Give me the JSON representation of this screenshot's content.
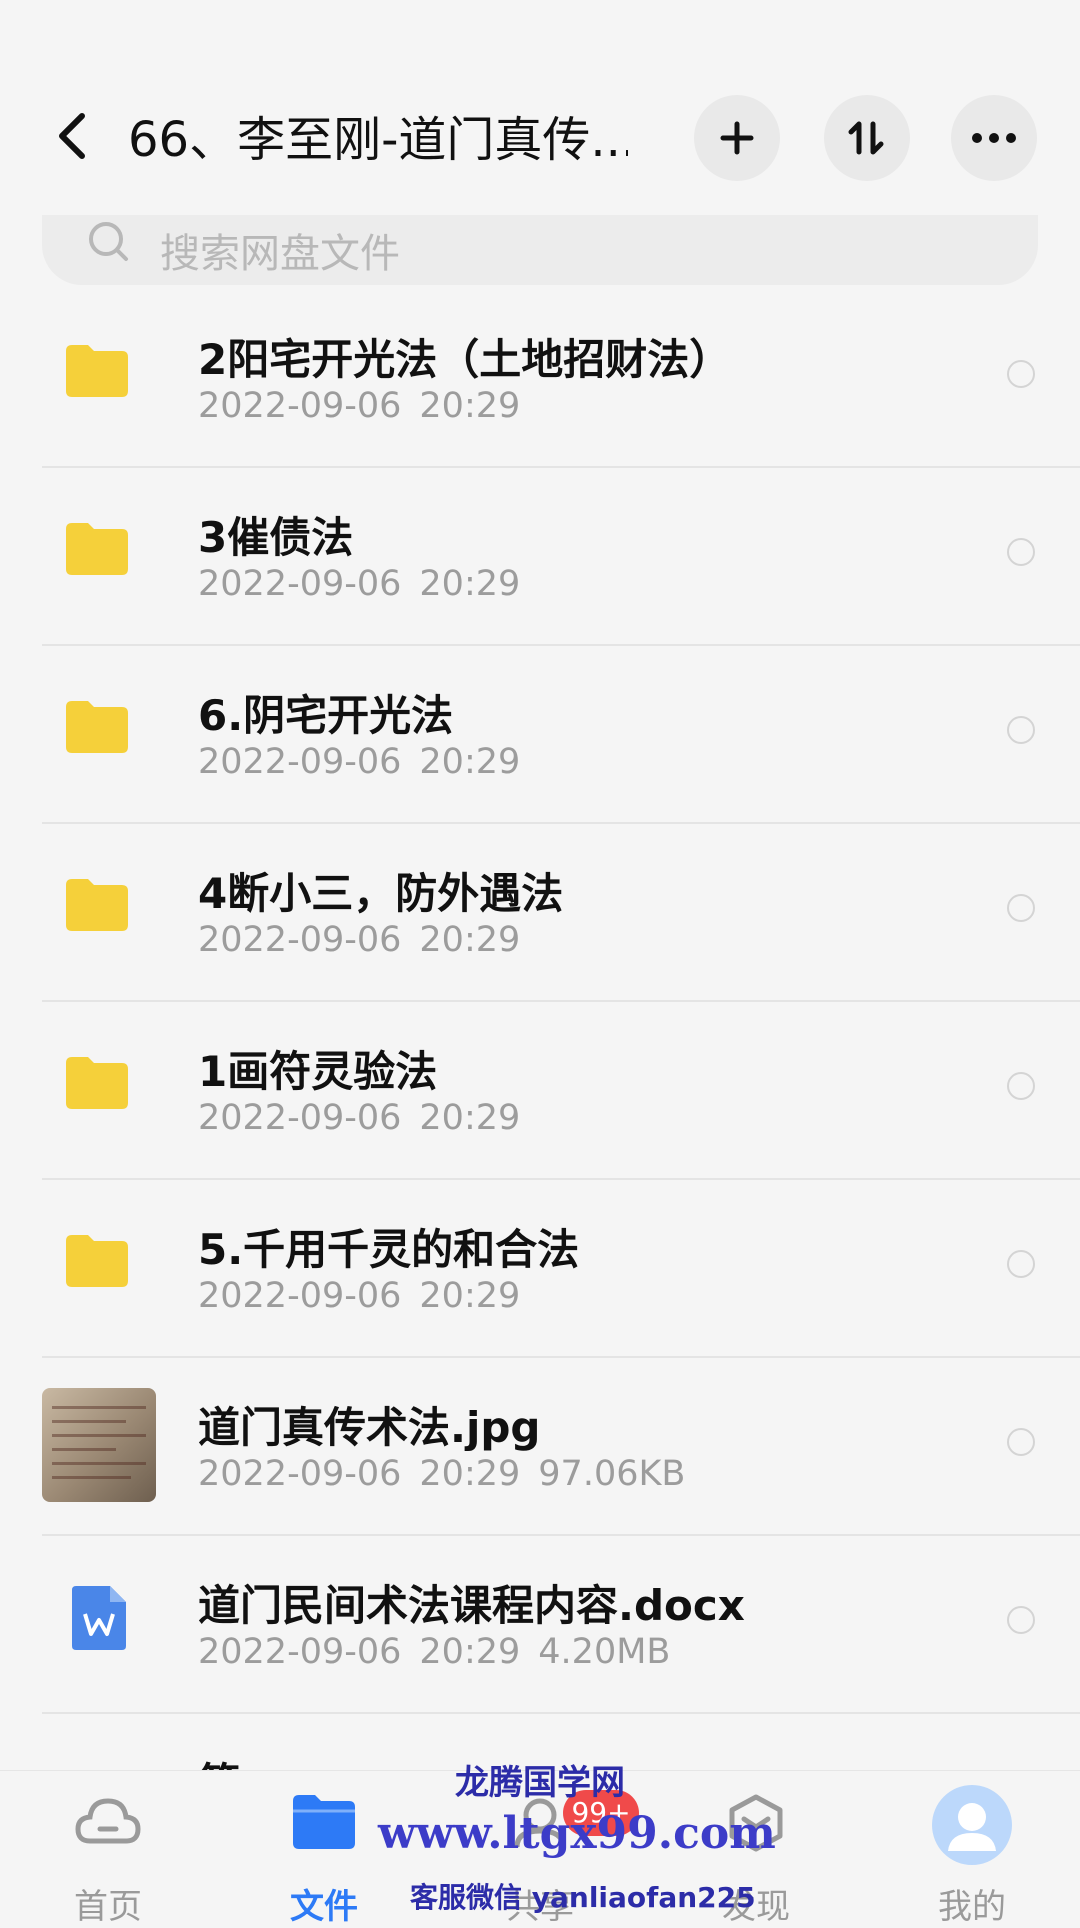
{
  "header": {
    "title": "66、李至刚-道门真传..."
  },
  "search": {
    "placeholder": "搜索网盘文件"
  },
  "files": [
    {
      "name": "2阳宅开光法（土地招财法）",
      "date": "2022-09-06",
      "time": "20:29",
      "size": "",
      "type": "folder"
    },
    {
      "name": "3催债法",
      "date": "2022-09-06",
      "time": "20:29",
      "size": "",
      "type": "folder"
    },
    {
      "name": "6.阴宅开光法",
      "date": "2022-09-06",
      "time": "20:29",
      "size": "",
      "type": "folder"
    },
    {
      "name": "4断小三，防外遇法",
      "date": "2022-09-06",
      "time": "20:29",
      "size": "",
      "type": "folder"
    },
    {
      "name": "1画符灵验法",
      "date": "2022-09-06",
      "time": "20:29",
      "size": "",
      "type": "folder"
    },
    {
      "name": "5.千用千灵的和合法",
      "date": "2022-09-06",
      "time": "20:29",
      "size": "",
      "type": "folder"
    },
    {
      "name": "道门真传术法.jpg",
      "date": "2022-09-06",
      "time": "20:29",
      "size": "97.06KB",
      "type": "image"
    },
    {
      "name": "道门民间术法课程内容.docx",
      "date": "2022-09-06",
      "time": "20:29",
      "size": "4.20MB",
      "type": "doc"
    }
  ],
  "partial_row": {
    "name": "第一"
  },
  "tabs": [
    {
      "label": "首页"
    },
    {
      "label": "文件"
    },
    {
      "label": "共享"
    },
    {
      "label": "发现"
    },
    {
      "label": "我的"
    }
  ],
  "badge": "99+",
  "watermark": {
    "line1": "龙腾国学网",
    "line2": "www.ltgx99.com",
    "line3": "客服微信 yanliaofan225"
  },
  "colors": {
    "accent": "#2d7af6",
    "folder": "#f5d03a",
    "badge": "#f04a4a"
  }
}
